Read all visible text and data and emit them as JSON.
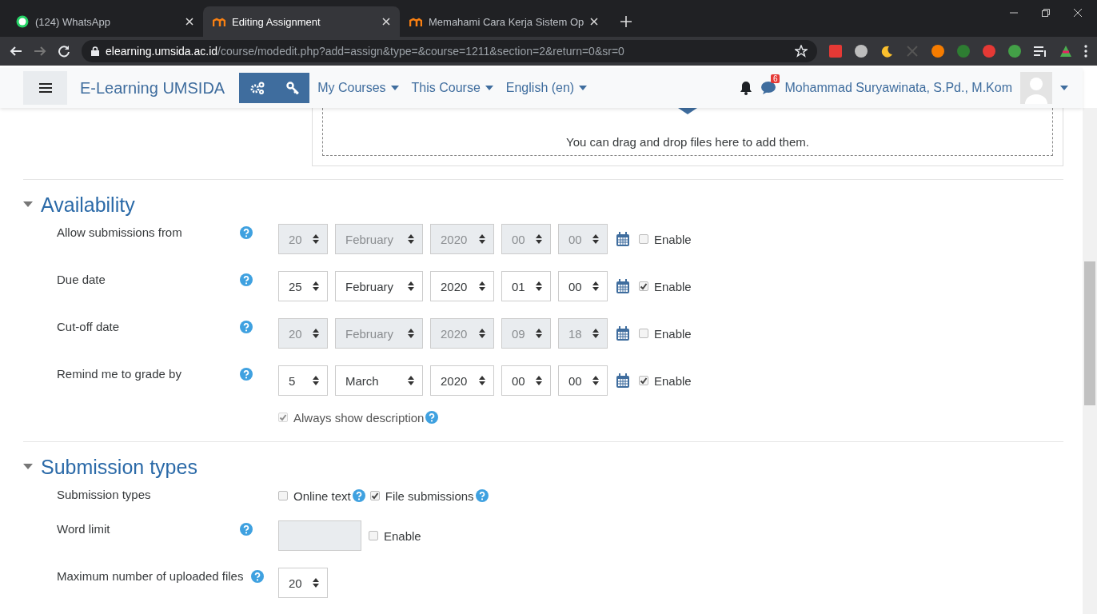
{
  "browser": {
    "tabs": [
      {
        "title": "(124) WhatsApp",
        "selected": false
      },
      {
        "title": "Editing Assignment",
        "selected": true
      },
      {
        "title": "Memahami Cara Kerja Sistem Op",
        "selected": false
      }
    ],
    "url": {
      "host": "elearning.umsida.ac.id",
      "path": "/course/modedit.php?add=assign&type=&course=1211&section=2&return=0&sr=0"
    }
  },
  "navbar": {
    "brand": "E-Learning UMSIDA",
    "menus": [
      "My Courses",
      "This Course",
      "English (en)"
    ],
    "message_count": "6",
    "user_name": "Mohammad Suryawinata, S.Pd., M.Kom"
  },
  "dropzone": {
    "text": "You can drag and drop files here to add them."
  },
  "sections": [
    {
      "title": "Availability",
      "expanded": true,
      "rows": [
        {
          "kind": "date",
          "label": "Allow submissions from",
          "help": true,
          "fields": [
            "20",
            "February",
            "2020",
            "00",
            "00"
          ],
          "enable_label": "Enable",
          "enabled": false
        },
        {
          "kind": "date",
          "label": "Due date",
          "help": true,
          "fields": [
            "25",
            "February",
            "2020",
            "01",
            "00"
          ],
          "enable_label": "Enable",
          "enabled": true
        },
        {
          "kind": "date",
          "label": "Cut-off date",
          "help": true,
          "fields": [
            "20",
            "February",
            "2020",
            "09",
            "18"
          ],
          "enable_label": "Enable",
          "enabled": false
        },
        {
          "kind": "date",
          "label": "Remind me to grade by",
          "help": true,
          "fields": [
            "5",
            "March",
            "2020",
            "00",
            "00"
          ],
          "enable_label": "Enable",
          "enabled": true
        },
        {
          "kind": "checkbox",
          "label": "",
          "help": false,
          "option": {
            "label": "Always show description",
            "checked": true,
            "disabled": true,
            "help": true
          }
        }
      ]
    },
    {
      "title": "Submission types",
      "expanded": true,
      "rows": [
        {
          "kind": "checks",
          "label": "Submission types",
          "help": false,
          "options": [
            {
              "label": "Online text",
              "checked": false,
              "help": true
            },
            {
              "label": "File submissions",
              "checked": true,
              "help": true
            }
          ]
        },
        {
          "kind": "limit",
          "label": "Word limit",
          "help": true,
          "value": "",
          "enable_label": "Enable",
          "enabled": false
        },
        {
          "kind": "select",
          "label": "Maximum number of uploaded files",
          "help": true,
          "help_inline": true,
          "value": "20"
        }
      ]
    }
  ]
}
